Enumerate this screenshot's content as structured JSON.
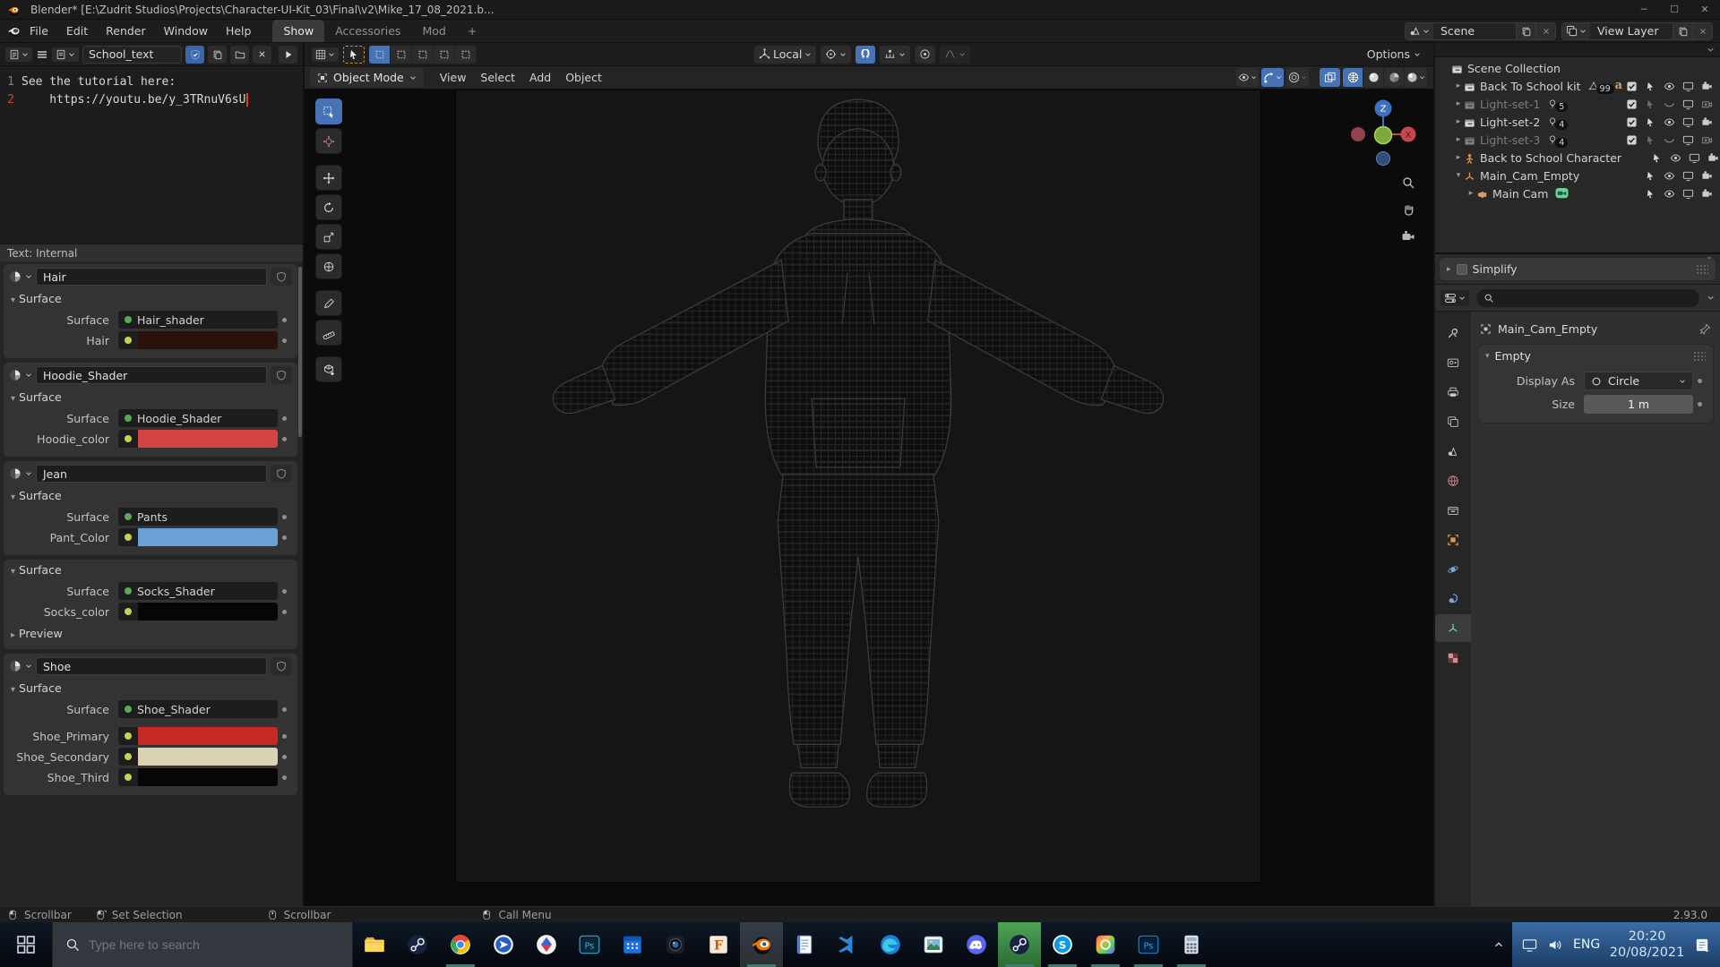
{
  "window": {
    "title": "Blender* [E:\\Zudrit Studios\\Projects\\Character-UI-Kit_03\\Final\\v2\\Mike_17_08_2021.b...",
    "controls": [
      "minimize",
      "maximize",
      "close"
    ]
  },
  "topbar": {
    "menus": [
      "File",
      "Edit",
      "Render",
      "Window",
      "Help"
    ],
    "workspaces": [
      {
        "label": "Show",
        "active": true
      },
      {
        "label": "Accessories",
        "active": false
      },
      {
        "label": "Mod",
        "active": false
      },
      {
        "label": "+",
        "active": false
      }
    ],
    "scene_label": "Scene",
    "view_layer_label": "View Layer"
  },
  "text_editor": {
    "datablock": "School_text",
    "footer": "Text: Internal",
    "lines": [
      {
        "n": "1",
        "text": "See the tutorial here:",
        "current": false
      },
      {
        "n": "2",
        "text": "    https://youtu.be/y_3TRnuV6sU",
        "current": true
      }
    ]
  },
  "materials": {
    "section_title": "Surface",
    "panels": [
      {
        "name": "Hair",
        "rows": [
          {
            "label": "Surface",
            "kind": "shader",
            "value": "Hair_shader"
          },
          {
            "label": "Hair",
            "kind": "color",
            "color": "#2a120b"
          }
        ]
      },
      {
        "name": "Hoodie_Shader",
        "rows": [
          {
            "label": "Surface",
            "kind": "shader",
            "value": "Hoodie_Shader"
          },
          {
            "label": "Hoodie_color",
            "kind": "color",
            "color": "#d24444"
          }
        ]
      },
      {
        "name": "Jean",
        "rows": [
          {
            "label": "Surface",
            "kind": "shader",
            "value": "Pants"
          },
          {
            "label": "Pant_Color",
            "kind": "color",
            "color": "#6aa2d8"
          }
        ]
      },
      {
        "name": null,
        "rows": [
          {
            "label": "Surface",
            "kind": "shader",
            "value": "Socks_Shader"
          },
          {
            "label": "Socks_color",
            "kind": "color",
            "color": "#060606"
          }
        ],
        "extra": "Preview"
      },
      {
        "name": "Shoe",
        "rows": [
          {
            "label": "Surface",
            "kind": "shader",
            "value": "Shoe_Shader"
          },
          {
            "label": "Shoe_Primary",
            "kind": "color",
            "color": "#c62a25",
            "gap": true
          },
          {
            "label": "Shoe_Secondary",
            "kind": "color",
            "color": "#dad2b2"
          },
          {
            "label": "Shoe_Third",
            "kind": "color",
            "color": "#060606"
          }
        ]
      }
    ]
  },
  "viewport": {
    "mode": "Object Mode",
    "menus": [
      "View",
      "Select",
      "Add",
      "Object"
    ],
    "orientation": "Local",
    "options_label": "Options",
    "toolbar": [
      "select-box",
      "cursor",
      "move",
      "rotate",
      "scale",
      "transform",
      "annotate",
      "measure",
      "add-cube"
    ],
    "gizmo_axis_top": "Z",
    "gizmo_axis_right": "X"
  },
  "outliner": {
    "items": [
      {
        "label": "Scene Collection",
        "icon": "collection",
        "depth": 0
      },
      {
        "label": "Back To School kit",
        "icon": "collection",
        "depth": 1,
        "expand": "closed",
        "badges": [
          {
            "icon": "mesh",
            "count": "99"
          },
          {
            "icon": "font"
          }
        ],
        "checkbox": true,
        "select": true,
        "eye": "open",
        "screen": true,
        "camera": "on"
      },
      {
        "label": "Light-set-1",
        "icon": "collection",
        "depth": 1,
        "expand": "closed",
        "dim": true,
        "badges": [
          {
            "icon": "light",
            "count": "5"
          }
        ],
        "checkbox": true,
        "select": false,
        "eye": "closed",
        "screen": true,
        "camera": "off"
      },
      {
        "label": "Light-set-2",
        "icon": "collection",
        "depth": 1,
        "expand": "closed",
        "badges": [
          {
            "icon": "light",
            "count": "4"
          }
        ],
        "checkbox": true,
        "select": true,
        "eye": "open",
        "screen": true,
        "camera": "on"
      },
      {
        "label": "Light-set-3",
        "icon": "collection",
        "depth": 1,
        "expand": "closed",
        "dim": true,
        "badges": [
          {
            "icon": "light",
            "count": "4"
          }
        ],
        "checkbox": true,
        "select": false,
        "eye": "closed",
        "screen": true,
        "camera": "off"
      },
      {
        "label": "Back to School Character",
        "icon": "armature",
        "depth": 1,
        "expand": "closed",
        "select": true,
        "eye": "open",
        "screen": true,
        "camera": "on"
      },
      {
        "label": "Main_Cam_Empty",
        "icon": "empty",
        "depth": 1,
        "expand": "open",
        "select": true,
        "eye": "open",
        "screen": true,
        "camera": "on"
      },
      {
        "label": "Main Cam",
        "icon": "camera-object",
        "depth": 2,
        "expand": "closed",
        "badges": [
          {
            "icon": "camera-data"
          }
        ],
        "select": true,
        "eye": "open",
        "screen": true,
        "camera": "on"
      }
    ]
  },
  "properties": {
    "simplify_label": "Simplify",
    "tabs": [
      {
        "name": "tool"
      },
      {
        "name": "render"
      },
      {
        "name": "output"
      },
      {
        "name": "view-layer"
      },
      {
        "name": "scene"
      },
      {
        "name": "world"
      },
      {
        "name": "collection"
      },
      {
        "name": "object"
      },
      {
        "name": "physics"
      },
      {
        "name": "constraints"
      },
      {
        "name": "object-data",
        "selected": true
      },
      {
        "name": "texture"
      }
    ],
    "breadcrumb": "Main_Cam_Empty",
    "panel_title": "Empty",
    "display_as_label": "Display As",
    "display_as_value": "Circle",
    "size_label": "Size",
    "size_value": "1 m"
  },
  "statusbar": {
    "hints": [
      {
        "icon": "mouse-left",
        "label": "Scrollbar"
      },
      {
        "icon": "mouse-drag",
        "label": "Set Selection"
      },
      {
        "icon": "mouse-middle",
        "label": "Scrollbar"
      },
      {
        "icon": "mouse-left",
        "label": "Call Menu"
      }
    ],
    "version": "2.93.0"
  },
  "taskbar": {
    "search_placeholder": "Type here to search",
    "apps": [
      {
        "name": "file-explorer"
      },
      {
        "name": "steam"
      },
      {
        "name": "chrome",
        "running": true
      },
      {
        "name": "app-circle-arrow"
      },
      {
        "name": "app-diamond"
      },
      {
        "name": "photoshop-dark"
      },
      {
        "name": "calendar"
      },
      {
        "name": "camera-app"
      },
      {
        "name": "f-app"
      },
      {
        "name": "blender",
        "active": true,
        "running": true
      },
      {
        "name": "notepad"
      },
      {
        "name": "vscode"
      },
      {
        "name": "edge"
      },
      {
        "name": "photos"
      },
      {
        "name": "discord"
      },
      {
        "name": "steam-green",
        "highlight": true,
        "running": true
      },
      {
        "name": "skype",
        "running": true
      },
      {
        "name": "adobe-cc",
        "running": true
      },
      {
        "name": "photoshop-blue",
        "running": true
      },
      {
        "name": "calculator",
        "running": true
      }
    ],
    "tray": {
      "lang": "ENG",
      "time": "20:20",
      "date": "20/08/2021"
    }
  },
  "colors": {
    "accent": "#4772b3",
    "blender_orange": "#ea7600",
    "active_tool_outline": "#c78a3c",
    "run_indicator": "#3e7a74"
  }
}
